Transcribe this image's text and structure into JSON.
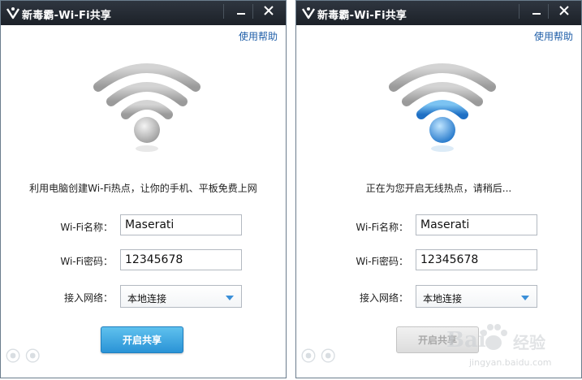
{
  "windows": [
    {
      "title": "新毒霸-Wi-Fi共享",
      "help": "使用帮助",
      "description": "利用电脑创建Wi-Fi热点，让你的手机、平板免费上网",
      "name_label": "Wi-Fi名称：",
      "name_value": "Maserati",
      "pwd_label": "Wi-Fi密码：",
      "pwd_value": "12345678",
      "net_label": "接入网络：",
      "net_value": "本地连接",
      "button": "开启共享",
      "state": "idle"
    },
    {
      "title": "新毒霸-Wi-Fi共享",
      "help": "使用帮助",
      "description": "正在为您开启无线热点，请稍后...",
      "name_label": "Wi-Fi名称：",
      "name_value": "Maserati",
      "pwd_label": "Wi-Fi密码：",
      "pwd_value": "12345678",
      "net_label": "接入网络：",
      "net_value": "本地连接",
      "button": "开启共享",
      "state": "connecting"
    }
  ],
  "watermark": {
    "brand": "Bai",
    "brand_suffix": "经验",
    "url": "jingyan.baidu.com"
  },
  "colors": {
    "titlebar": "#1c2128",
    "accent": "#2a93d6",
    "wifi_idle": "#a9a9a9",
    "wifi_active": "#3a8fd8"
  }
}
